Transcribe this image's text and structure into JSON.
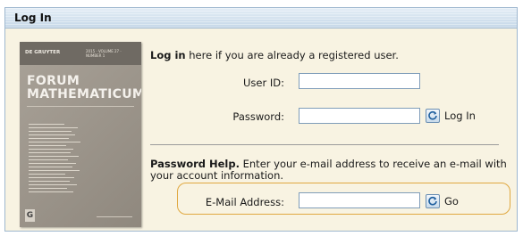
{
  "panel": {
    "title": "Log In",
    "header_color": "#c9dbea",
    "background_color": "#f8f3e2"
  },
  "cover": {
    "publisher": "DE GRUYTER",
    "issue": "2015 · VOLUME 27 · NUMBER 1",
    "title_line1": "FORUM",
    "title_line2": "MATHEMATICUM",
    "logo": "G"
  },
  "login": {
    "intro_bold": "Log in",
    "intro_rest": " here if you are already a registered user.",
    "user_id_label": "User ID:",
    "user_id_value": "",
    "password_label": "Password:",
    "password_value": "",
    "login_button_label": "Log In",
    "login_button_icon": "refresh-icon"
  },
  "password_help": {
    "heading": "Password Help.",
    "text": " Enter your e-mail address to receive an e-mail with your account information.",
    "email_label": "E-Mail Address:",
    "email_value": "",
    "go_button_label": "Go",
    "go_button_icon": "refresh-icon",
    "highlight_color": "#e0a840"
  }
}
